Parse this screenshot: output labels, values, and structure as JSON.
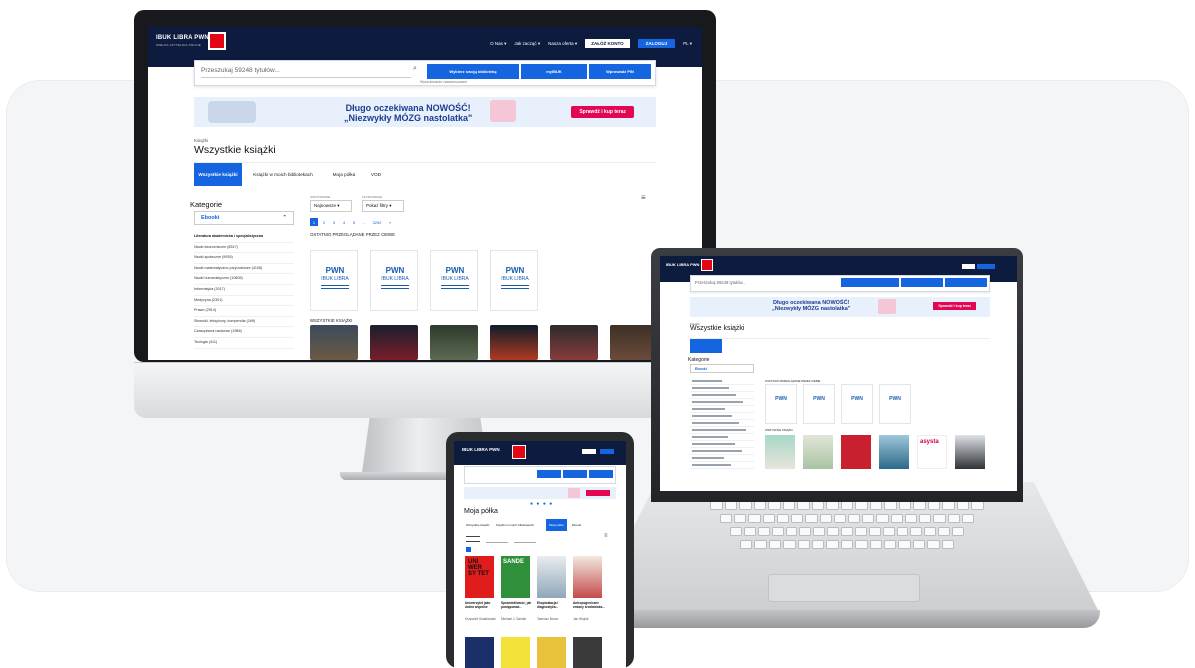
{
  "imac": {
    "nav": {
      "logo": "IBUK LIBRA PWN",
      "logo_sub": "WIELKA CZYTELNIA ONLINE",
      "links": [
        "O Nas ▾",
        "Jak zacząć ▾",
        "Nasza oferta ▾"
      ],
      "btn_register": "ZAŁÓŻ KONTO",
      "btn_login": "ZALOGUJ",
      "lang": "PL ▾"
    },
    "search": {
      "placeholder": "Przeszukaj 59248 tytułów...",
      "btn_library": "Wybierz swoją bibliotekę",
      "btn_mypwn": "myIBUK",
      "btn_pin": "Wprowadź PIN",
      "advanced": "Wyszukiwanie zaawansowane"
    },
    "banner": {
      "line1": "Długo oczekiwana NOWOŚĆ!",
      "line2": "„Niezwykły MÓZG nastolatka\"",
      "cta": "Sprawdź i kup teraz"
    },
    "breadcrumb": "Książki",
    "title": "Wszystkie książki",
    "tabs": [
      "Wszystkie książki",
      "Książki w moich bibliotekach",
      "Moja półka",
      "VOD"
    ],
    "categories_heading": "Kategorie",
    "ebooki": "Ebooki",
    "categories": [
      "Literatura akademicka i specjalistyczna",
      "Nauki ekonomiczne (8517)",
      "Nauki społeczne (9935)",
      "Nauki matematyczno-przyrodnicze (4108)",
      "Nauki humanistyczne (10805)",
      "Informatyka (3017)",
      "Medycyna (2301)",
      "Prawo (2914)",
      "Słowniki, leksykony, kompendia (169)",
      "Czasopisma naukowe (1986)",
      "Teologia (411)"
    ],
    "sort": {
      "label": "SORTOWANIE",
      "value": "Najnowsze ▾"
    },
    "filter": {
      "label": "FILTROWANIE",
      "value": "Pokaż filtry ▾"
    },
    "pages": [
      "1",
      "2",
      "3",
      "4",
      "5",
      "...",
      "3292",
      "»"
    ],
    "recent_heading": "OSTATNIO PRZEGLĄDANE PRZEZ CIEBIE",
    "all_heading": "WSZYSTKIE KSIĄŻKI",
    "pwn_mark": "PWN",
    "pwn_sub": "IBUK LIBRA"
  },
  "laptop": {
    "title": "Wszystkie książki",
    "breadcrumb": "Książki",
    "categories_heading": "Kategorie",
    "ebooki": "Ebooki",
    "recent_heading": "OSTATNIO PRZEGLĄDANE PRZEZ CIEBIE",
    "all_heading": "WSZYSTKIE KSIĄŻKI",
    "search_placeholder": "Przeszukaj 59248 tytułów...",
    "banner_line1": "Długo oczekiwana NOWOŚĆ!",
    "banner_line2": "„Niezwykły MÓZG nastolatka\"",
    "banner_cta": "Sprawdź i kup teraz",
    "book_label": "asysta"
  },
  "tablet": {
    "title": "Moja półka",
    "tabs": [
      "Wszystkie książki",
      "Książki w moich bibliotekach",
      "Moja półka",
      "Ebooki"
    ],
    "books": [
      {
        "title": "Uniwersytet jako dobro wspólne",
        "author": "Krzysztof Szadkowski"
      },
      {
        "title": "Sprawiedliwość, jak postępować...",
        "author": "Michael J. Sandel"
      },
      {
        "title": "Eksploatacja i diagnostyka...",
        "author": "Tadeusz Bruno"
      },
      {
        "title": "Antropogeniczne zmiany środowiska...",
        "author": "Jan Wojcik"
      }
    ],
    "cover1_text": "UNI WER SY TET",
    "cover2_text": "SANDE"
  }
}
